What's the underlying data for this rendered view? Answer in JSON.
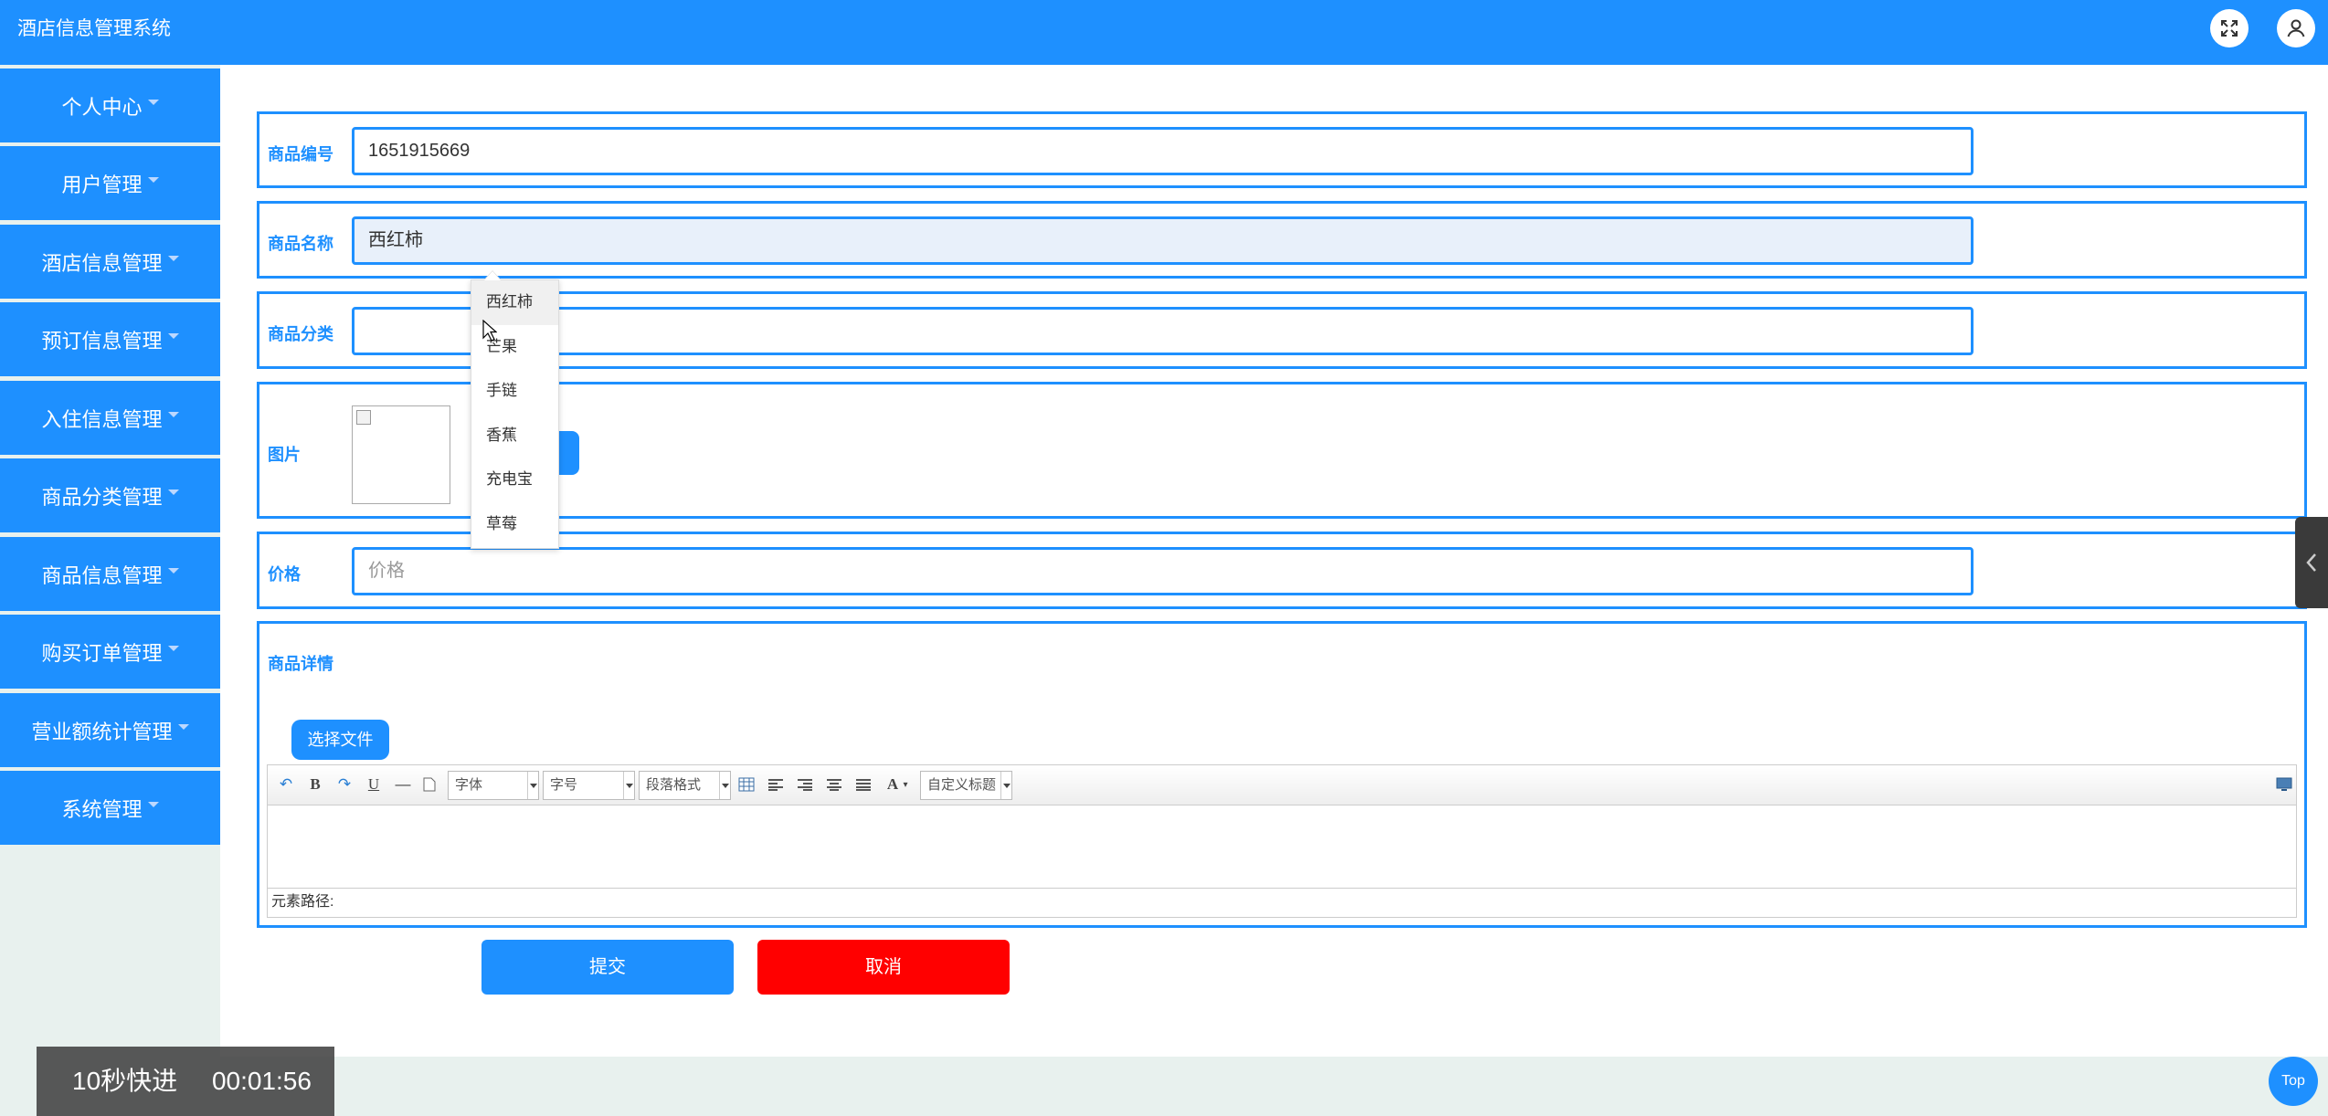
{
  "app": {
    "title": "酒店信息管理系统"
  },
  "header": {
    "fullscreen_icon": "fullscreen-icon",
    "user_icon": "user-icon"
  },
  "sidebar": {
    "items": [
      {
        "label": "个人中心"
      },
      {
        "label": "用户管理"
      },
      {
        "label": "酒店信息管理"
      },
      {
        "label": "预订信息管理"
      },
      {
        "label": "入住信息管理"
      },
      {
        "label": "商品分类管理"
      },
      {
        "label": "商品信息管理"
      },
      {
        "label": "购买订单管理"
      },
      {
        "label": "营业额统计管理"
      },
      {
        "label": "系统管理"
      }
    ]
  },
  "form": {
    "code": {
      "label": "商品编号",
      "value": "1651915669"
    },
    "name": {
      "label": "商品名称",
      "value": "西红柿"
    },
    "category": {
      "label": "商品分类",
      "value": ""
    },
    "image": {
      "label": "图片"
    },
    "price": {
      "label": "价格",
      "placeholder": "价格"
    },
    "detail": {
      "label": "商品详情",
      "file_button": "选择文件"
    }
  },
  "autocomplete": {
    "options": [
      "西红柿",
      "芒果",
      "手链",
      "香蕉",
      "充电宝",
      "草莓"
    ],
    "highlighted": "西红柿"
  },
  "editor": {
    "font_select": "字体",
    "size_select": "字号",
    "paragraph_select": "段落格式",
    "custom_title_select": "自定义标题",
    "element_path": "元素路径:"
  },
  "actions": {
    "submit": "提交",
    "cancel": "取消"
  },
  "misc": {
    "top_button": "Top"
  },
  "player_overlay": {
    "speed_label": "10秒快进",
    "time": "00:01:56"
  },
  "colors": {
    "primary": "#1e90ff",
    "danger": "#ff0000",
    "background": "#e8f1ee"
  }
}
